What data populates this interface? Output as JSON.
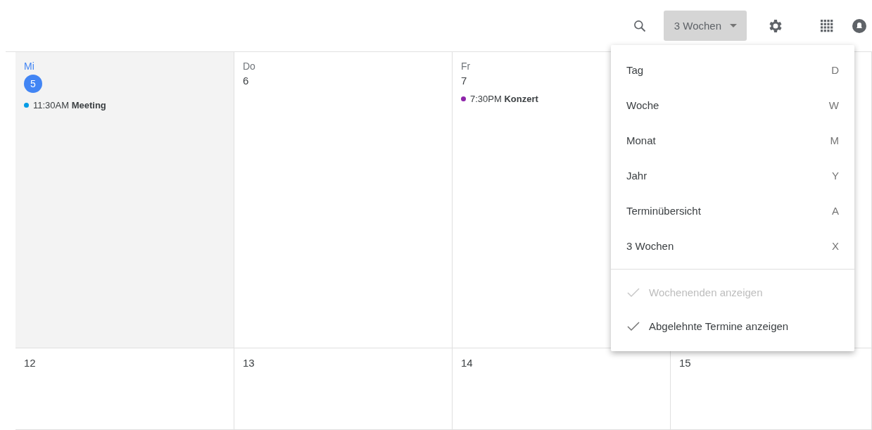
{
  "toolbar": {
    "view_button": {
      "label": "3 Wochen"
    }
  },
  "weeks": [
    {
      "days": [
        {
          "weekday": "Mi",
          "date": "5",
          "today": true,
          "events": [
            {
              "time": "11:30AM",
              "title": "Meeting",
              "color": "#039be5"
            }
          ]
        },
        {
          "weekday": "Do",
          "date": "6",
          "today": false
        },
        {
          "weekday": "Fr",
          "date": "7",
          "today": false,
          "events": [
            {
              "time": "7:30PM",
              "title": "Konzert",
              "color": "#8e24aa"
            }
          ]
        },
        {
          "today": false
        }
      ]
    },
    {
      "days": [
        {
          "date": "12",
          "today": false
        },
        {
          "date": "13",
          "today": false
        },
        {
          "date": "14",
          "today": false
        },
        {
          "date": "15",
          "today": false
        }
      ]
    }
  ],
  "view_menu": {
    "views": [
      {
        "label": "Tag",
        "shortcut": "D"
      },
      {
        "label": "Woche",
        "shortcut": "W"
      },
      {
        "label": "Monat",
        "shortcut": "M"
      },
      {
        "label": "Jahr",
        "shortcut": "Y"
      },
      {
        "label": "Terminübersicht",
        "shortcut": "A"
      },
      {
        "label": "3 Wochen",
        "shortcut": "X"
      }
    ],
    "options": [
      {
        "label": "Wochenenden anzeigen",
        "checked": true,
        "disabled": true
      },
      {
        "label": "Abgelehnte Termine anzeigen",
        "checked": true,
        "disabled": false
      }
    ]
  }
}
